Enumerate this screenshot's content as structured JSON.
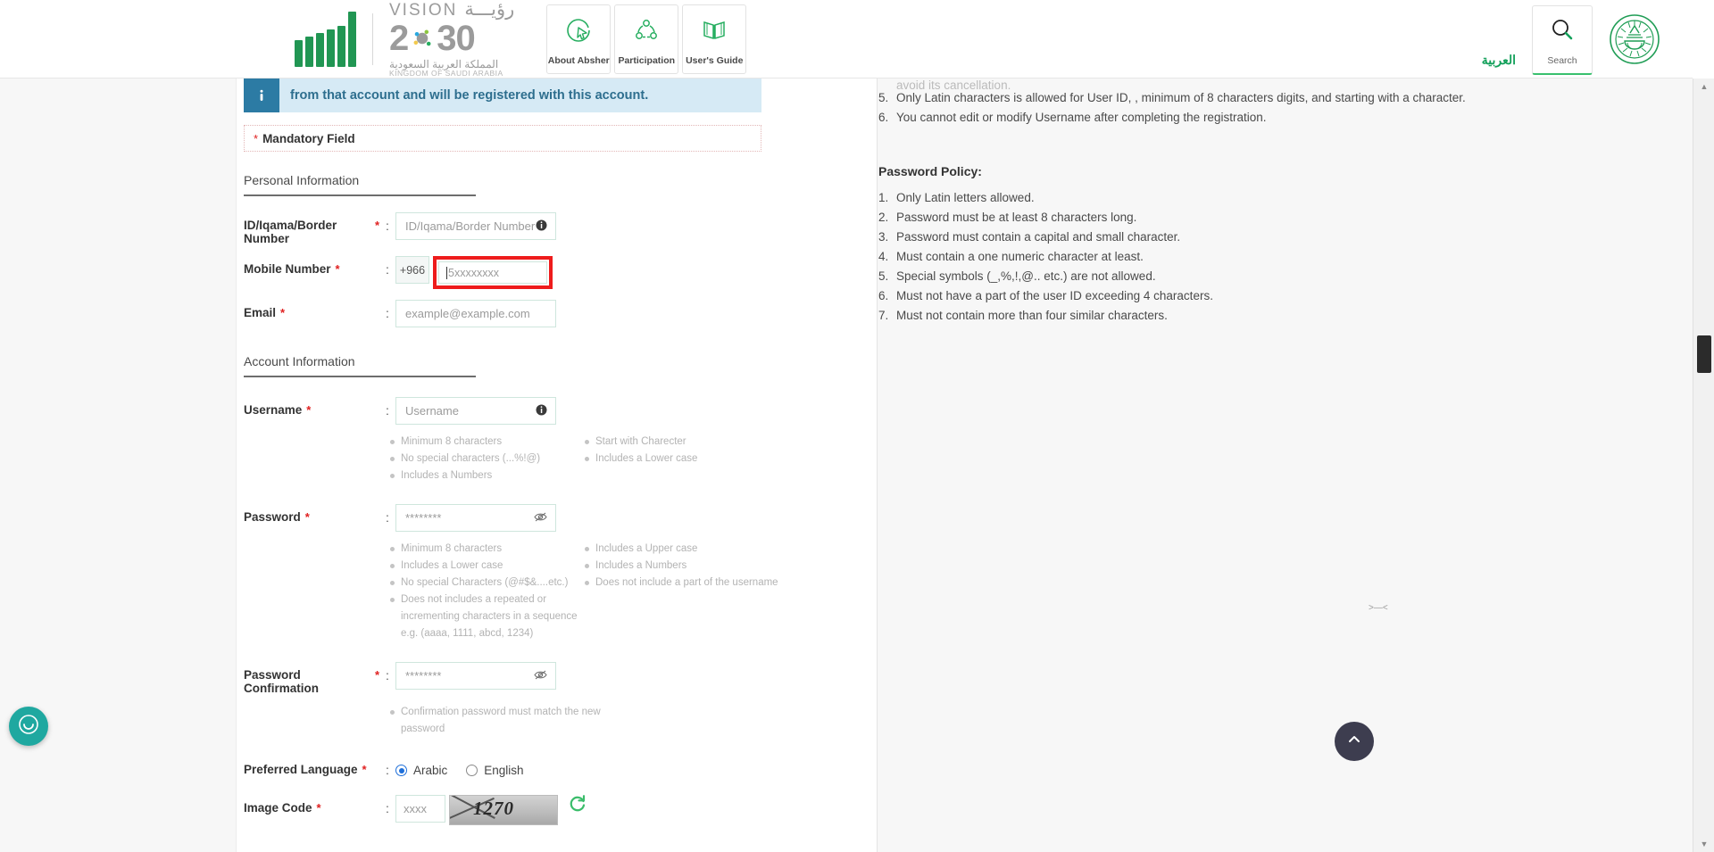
{
  "header": {
    "logo": {
      "vision_word": "VISION",
      "vision_arabic": "رؤيـــة",
      "vision_year": "2030",
      "kingdom_arabic": "المملكة العربية السعودية",
      "kingdom_english": "KINGDOM OF SAUDI ARABIA"
    },
    "nav_tiles": [
      {
        "label": "About Absher",
        "icon": "cursor-circle-icon"
      },
      {
        "label": "Participation",
        "icon": "network-nodes-icon"
      },
      {
        "label": "User's Guide",
        "icon": "open-book-icon"
      }
    ],
    "arabic_link": "العربية",
    "search_label": "Search",
    "emblem": "saudi-emblem-icon"
  },
  "banner": {
    "text": "from that account and will be registered with this account.",
    "icon": "info-icon"
  },
  "mandatory": {
    "star": "*",
    "label": "Mandatory Field"
  },
  "sections": {
    "personal": "Personal Information",
    "account": "Account Information"
  },
  "fields": {
    "id_number": {
      "label": "ID/Iqama/Border Number",
      "placeholder": "ID/Iqama/Border Number",
      "required": "*",
      "colon": ":"
    },
    "mobile": {
      "label": "Mobile Number",
      "prefix": "+966",
      "placeholder": "5xxxxxxxx",
      "required": "*",
      "colon": ":",
      "focused": true,
      "focus_color": "#ee1c1c"
    },
    "email": {
      "label": "Email",
      "placeholder": "example@example.com",
      "required": "*",
      "colon": ":"
    },
    "username": {
      "label": "Username",
      "placeholder": "Username",
      "required": "*",
      "colon": ":"
    },
    "password": {
      "label": "Password",
      "placeholder": "********",
      "required": "*",
      "colon": ":"
    },
    "password_confirmation": {
      "label": "Password Confirmation",
      "placeholder": "********",
      "required": "*",
      "colon": ":"
    },
    "preferred_language": {
      "label": "Preferred Language",
      "required": "*",
      "colon": ":",
      "options": [
        {
          "label": "Arabic",
          "selected": true
        },
        {
          "label": "English",
          "selected": false
        }
      ]
    },
    "image_code": {
      "label": "Image Code",
      "placeholder": "xxxx",
      "required": "*",
      "colon": ":",
      "captcha_text": "1270",
      "refresh_icon": "refresh-icon"
    }
  },
  "username_hints": {
    "col1": [
      "Minimum 8 characters",
      "No special characters (...%!@)",
      "Includes a Numbers"
    ],
    "col2": [
      "Start with Charecter",
      "Includes a Lower case"
    ]
  },
  "password_hints": {
    "col1": [
      "Minimum 8 characters",
      "Includes a Lower case",
      "No special Characters (@#$&....etc.)",
      "Does not includes a repeated or incrementing characters in a sequence e.g. (aaaa, 1111, abcd, 1234)"
    ],
    "col2": [
      "Includes a Upper case",
      "Includes a Numbers",
      "Does not include a part of the username"
    ]
  },
  "confirmation_hints": [
    "Confirmation password must match the new password"
  ],
  "right_panel": {
    "truncated_line": "avoid its cancellation.",
    "username_rules": [
      {
        "n": "5.",
        "text": "Only Latin characters is allowed for User ID, , minimum of 8 characters digits, and starting with a character."
      },
      {
        "n": "6.",
        "text": "You cannot edit or modify Username after completing the registration."
      }
    ],
    "password_policy_title": "Password Policy:",
    "password_policy": [
      {
        "n": "1.",
        "text": "Only Latin letters allowed."
      },
      {
        "n": "2.",
        "text": "Password must be at least 8 characters long."
      },
      {
        "n": "3.",
        "text": "Password must contain a capital and small character."
      },
      {
        "n": "4.",
        "text": "Must contain a one numeric character at least."
      },
      {
        "n": "5.",
        "text": "Special symbols (_,%,!,@.. etc.) are not allowed."
      },
      {
        "n": "6.",
        "text": "Must not have a part of the user ID exceeding 4 characters."
      },
      {
        "n": "7.",
        "text": "Must not contain more than four similar characters."
      }
    ]
  },
  "widgets": {
    "chat_icon": "chat-support-icon",
    "back_to_top_icon": "chevron-up-icon",
    "side_tab_icon": "collapse-arrows-icon"
  },
  "colors": {
    "brand_green": "#219653",
    "link_green": "#13a05a",
    "required_red": "#e02020",
    "focus_red": "#ee1c1c",
    "banner_bg": "#d6eaf5",
    "banner_accent": "#2c7ba4",
    "field_border": "#cfe6dd"
  }
}
